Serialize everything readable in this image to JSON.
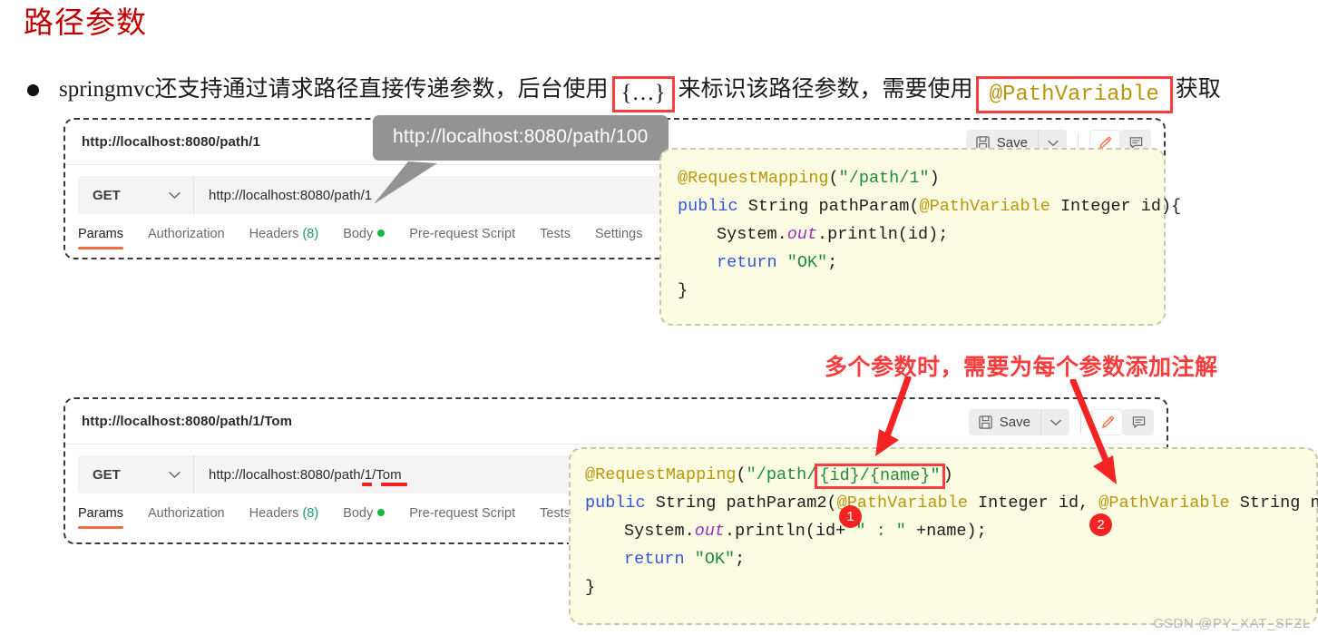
{
  "slide": {
    "title": "路径参数",
    "bullet": {
      "text_before": "springmvc还支持通过请求路径直接传递参数，后台使用",
      "highlight_braces": "{…}",
      "text_middle": "来标识该路径参数，需要使用",
      "highlight_annotation": "@PathVariable",
      "text_after": "获取"
    },
    "red_note": "多个参数时，需要为每个参数添加注解",
    "watermark": "CSDN @PY_XAT_SFZL"
  },
  "callout": {
    "text": "http://localhost:8080/path/100"
  },
  "postman_1": {
    "tab_title": "http://localhost:8080/path/1",
    "method": "GET",
    "method_caret": "⌄",
    "url": "http://localhost:8080/path/1",
    "save_label": "Save",
    "save_caret": "⌄",
    "tabs": [
      {
        "label": "Params",
        "active": true
      },
      {
        "label": "Authorization",
        "active": false
      },
      {
        "label": "Headers",
        "count": "(8)",
        "active": false
      },
      {
        "label": "Body",
        "dot": true,
        "active": false
      },
      {
        "label": "Pre-request Script",
        "active": false
      },
      {
        "label": "Tests",
        "active": false
      },
      {
        "label": "Settings",
        "active": false
      }
    ]
  },
  "postman_2": {
    "tab_title": "http://localhost:8080/path/1/Tom",
    "method": "GET",
    "method_caret": "⌄",
    "url": "http://localhost:8080/path/1/Tom",
    "save_label": "Save",
    "save_caret": "⌄",
    "tabs": [
      {
        "label": "Params",
        "active": true
      },
      {
        "label": "Authorization",
        "active": false
      },
      {
        "label": "Headers",
        "count": "(8)",
        "active": false
      },
      {
        "label": "Body",
        "dot": true,
        "active": false
      },
      {
        "label": "Pre-request Script",
        "active": false
      },
      {
        "label": "Tests",
        "active": false
      }
    ]
  },
  "code_1": {
    "l1_ann": "@RequestMapping",
    "l1_open": "(",
    "l1_str": "\"/path/1\"",
    "l1_close": ")",
    "l2_kw": "public",
    "l2_type": "String",
    "l2_fn": "pathParam",
    "l2_open": "(",
    "l2_ann": "@PathVariable",
    "l2_arg_type": "Integer",
    "l2_arg_name": "id",
    "l2_close": "){",
    "l3_sys": "System.",
    "l3_out": "out",
    "l3_rest": ".println(id);",
    "l4_kw": "return",
    "l4_str": "\"OK\"",
    "l4_semi": ";",
    "l5_brace": "}"
  },
  "code_2": {
    "l1_ann": "@RequestMapping",
    "l1_open": "(",
    "l1_str_a": "\"/path/",
    "l1_str_boxed": "{id}/{name}\"",
    "l1_close": ")",
    "l2_kw": "public",
    "l2_type": "String",
    "l2_fn": "pathParam2",
    "l2_open": "(",
    "l2_ann1": "@PathVariable",
    "l2_type1": "Integer",
    "l2_name1": "id,",
    "l2_ann2": "@PathVariable",
    "l2_type2": "String",
    "l2_name2": "name",
    "l2_close": "){",
    "l3_sys": "System.",
    "l3_out": "out",
    "l3_rest_a": ".println(id+",
    "l3_str": "\" : \"",
    "l3_rest_b": "+name);",
    "l4_kw": "return",
    "l4_str": "\"OK\"",
    "l4_semi": ";",
    "l5_brace": "}"
  },
  "badges": {
    "one": "1",
    "two": "2"
  },
  "colors": {
    "title_red": "#c00000",
    "accent_red": "#fa3c3c",
    "annotation_gold": "#b8960b",
    "keyword_blue": "#3355dd",
    "string_green": "#1f8a3e",
    "code_bg": "#fcfce2",
    "postman_orange": "#f26c3d",
    "body_dot_green": "#14b83e"
  }
}
